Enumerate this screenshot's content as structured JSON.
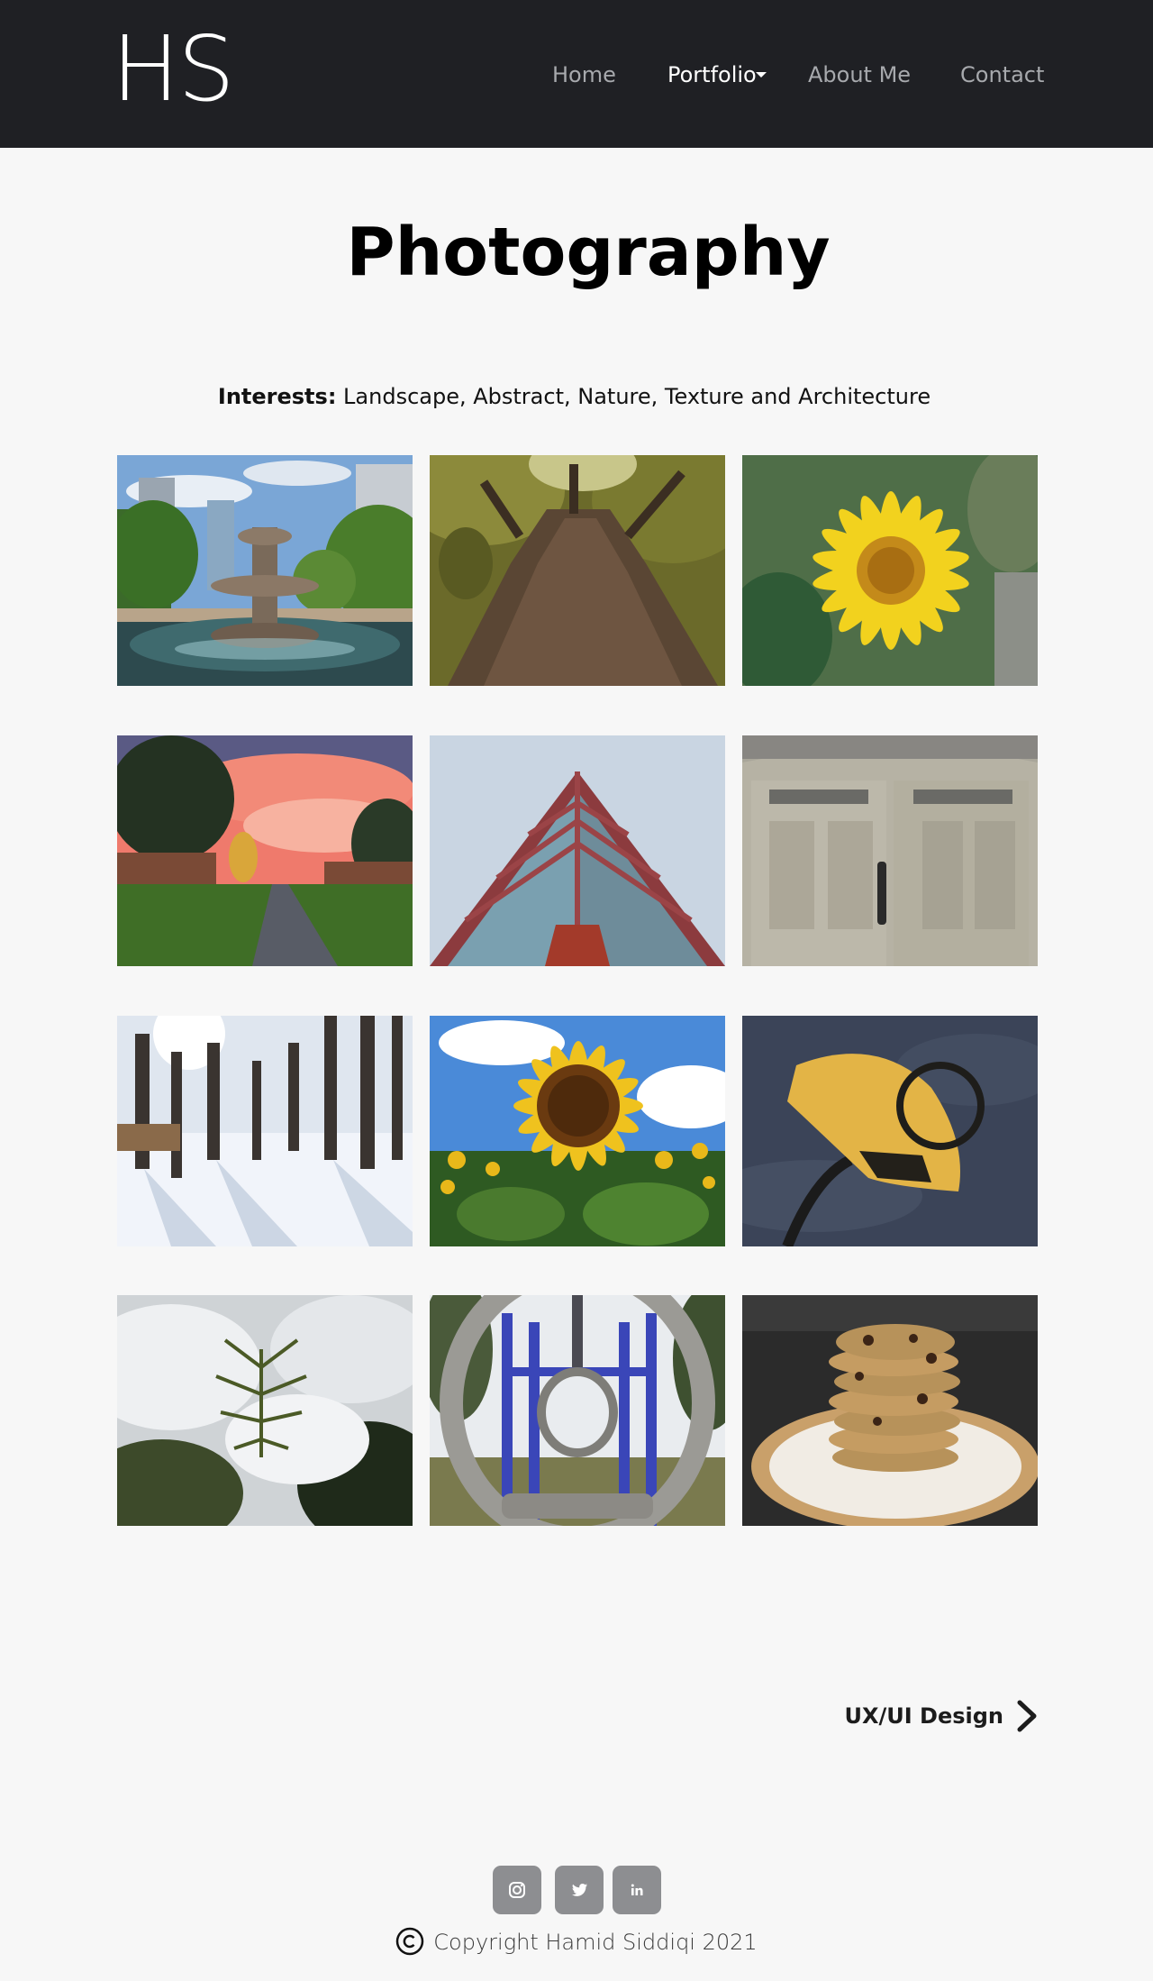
{
  "site": {
    "logo": "HS"
  },
  "nav": {
    "items": [
      {
        "label": "Home",
        "active": false
      },
      {
        "label": "Portfolio",
        "active": true,
        "has_dropdown": true
      },
      {
        "label": "About Me",
        "active": false
      },
      {
        "label": "Contact",
        "active": false
      }
    ]
  },
  "page": {
    "title": "Photography",
    "interests_label": "Interests:",
    "interests_text": " Landscape, Abstract, Nature, Texture and Architecture"
  },
  "gallery": {
    "photos": [
      {
        "subject": "fountain-in-park"
      },
      {
        "subject": "tree-trunk-from-below"
      },
      {
        "subject": "yellow-daisy"
      },
      {
        "subject": "sunset-path"
      },
      {
        "subject": "glass-building-corner"
      },
      {
        "subject": "white-doors"
      },
      {
        "subject": "snowy-forest"
      },
      {
        "subject": "sunflower-field"
      },
      {
        "subject": "yellow-sculpture"
      },
      {
        "subject": "pine-branch-in-snow"
      },
      {
        "subject": "playground-rings"
      },
      {
        "subject": "stack-of-cookies"
      }
    ]
  },
  "next_page": {
    "label": "UX/UI Design",
    "icon": "chevron-right-icon"
  },
  "footer": {
    "social": [
      {
        "name": "instagram",
        "icon": "instagram-icon"
      },
      {
        "name": "twitter",
        "icon": "twitter-icon"
      },
      {
        "name": "linkedin",
        "icon": "linkedin-icon"
      }
    ],
    "copyright": "Copyright Hamid Siddiqi 2021"
  },
  "colors": {
    "navbar_bg": "#1f2024",
    "page_bg": "#f7f7f7",
    "nav_inactive": "#a7a9ad",
    "nav_active": "#ffffff",
    "social_btn": "#8d8e91"
  }
}
